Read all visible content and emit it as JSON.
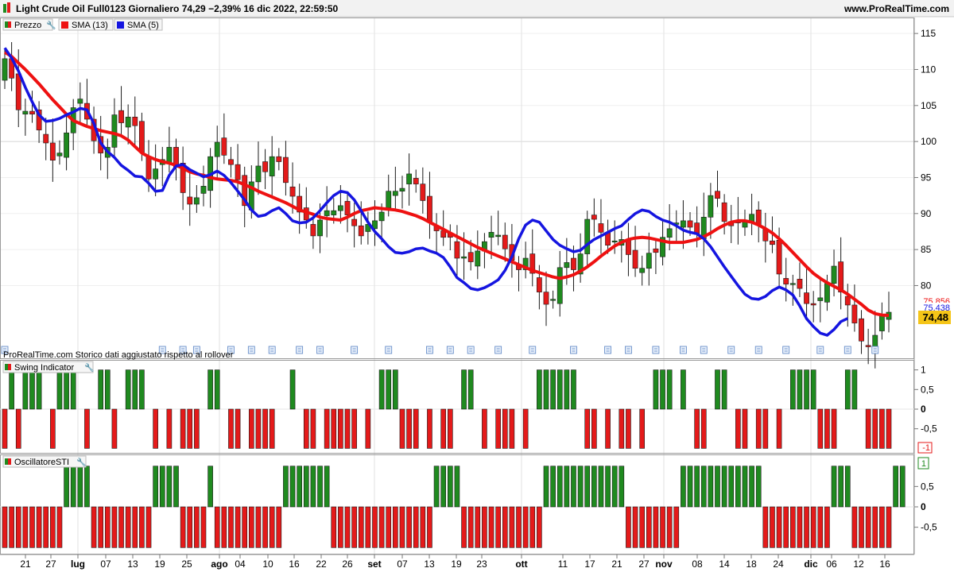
{
  "header": {
    "title": "Light Crude Oil Full0123 Giornaliero 74,29 −2,39% 16 dic 2022, 22:59:50",
    "site": "www.ProRealTime.com"
  },
  "price_panel": {
    "legend": [
      "Prezzo",
      "SMA (13)",
      "SMA (5)"
    ],
    "axis_ticks": [
      "115",
      "110",
      "105",
      "100",
      "95",
      "90",
      "85",
      "80"
    ],
    "label_sma13": "75,856",
    "label_sma5": "75,438",
    "label_last": "74,48",
    "footer": "ProRealTime.com Storico dati aggiustato rispetto al rollover"
  },
  "swing_panel": {
    "title": "Swing Indicator",
    "axis_ticks": [
      "1",
      "0,5",
      "0",
      "-0,5"
    ],
    "label_last": "-1"
  },
  "sti_panel": {
    "title": "OscillatoreSTI",
    "axis_ticks": [
      "0,5",
      "0",
      "-0,5"
    ],
    "label_last": "1"
  },
  "x_axis": {
    "labels": [
      "21",
      "27",
      "lug",
      "07",
      "13",
      "19",
      "25",
      "ago",
      "04",
      "10",
      "16",
      "22",
      "26",
      "set",
      "07",
      "13",
      "19",
      "23",
      "ott",
      "11",
      "17",
      "21",
      "27",
      "nov",
      "08",
      "14",
      "18",
      "24",
      "dic",
      "06",
      "12",
      "16"
    ]
  },
  "colors": {
    "up": "#1f8a1f",
    "down": "#e41a1a",
    "sma13": "#ee1111",
    "sma5": "#1515e0",
    "last_price_bg": "#f5c518"
  },
  "chart_data": {
    "type": "candlestick",
    "title": "Light Crude Oil Full0123 Giornaliero",
    "price_range": [
      72,
      118
    ],
    "sessions": 130,
    "ohlc_close": [
      111.5,
      108.8,
      104.4,
      104.2,
      103.8,
      101.6,
      99.8,
      97.4,
      98.4,
      101.2,
      104.7,
      105.9,
      103.1,
      100.1,
      98.4,
      99.2,
      103.7,
      102.6,
      103.4,
      102.2,
      98.5,
      94.8,
      96.2,
      97.5,
      99.2,
      96.4,
      92.9,
      91.3,
      92.2,
      93.8,
      97.9,
      99.9,
      98.1,
      96.8,
      94.7,
      91.1,
      94.4,
      96.6,
      95.8,
      97.9,
      97.2,
      94.3,
      92.4,
      90.2,
      89.1,
      86.9,
      89.1,
      90.4,
      90.4,
      91.1,
      89.8,
      88.3,
      86.9,
      88.5,
      89.0,
      90.2,
      93.1,
      93.1,
      93.5,
      95.5,
      94.1,
      91.8,
      88.9,
      87.6,
      86.7,
      86.7,
      83.8,
      84.0,
      83.3,
      84.8,
      86.1,
      87.4,
      87.0,
      85.1,
      83.5,
      82.2,
      83.8,
      81.7,
      79.1,
      77.4,
      78.1,
      82.5,
      83.2,
      82.2,
      84.4,
      89.2,
      89.2,
      87.4,
      85.6,
      86.2,
      86.4,
      84.3,
      82.4,
      82.4,
      84.5,
      84.6,
      86.7,
      87.9,
      88.7,
      89.0,
      88.1,
      87.1,
      89.5,
      92.5,
      92.1,
      88.9,
      88.3,
      88.7,
      88.8,
      89.9,
      88.4,
      86.2,
      85.7,
      81.6,
      80.2,
      80.3,
      79.6,
      77.5,
      77.3,
      78.3,
      80.3,
      82.7,
      79.1,
      77.3,
      74.8,
      72.3,
      71.5,
      73.1,
      75.9,
      76.3
    ],
    "sma13": [
      112.4,
      111.8,
      110.9,
      110.0,
      109.0,
      108.0,
      106.9,
      105.8,
      104.8,
      103.8,
      102.9,
      102.5,
      102.1,
      101.8,
      101.5,
      101.3,
      101.1,
      100.8,
      100.2,
      99.3,
      98.4,
      97.9,
      97.5,
      97.2,
      97.0,
      96.7,
      96.3,
      95.8,
      95.5,
      95.3,
      95.0,
      94.8,
      94.7,
      94.6,
      94.4,
      94.0,
      93.6,
      93.1,
      92.7,
      92.3,
      91.9,
      91.5,
      91.0,
      90.5,
      90.2,
      89.9,
      89.5,
      89.3,
      89.2,
      89.1,
      89.5,
      90.0,
      90.4,
      90.6,
      90.8,
      90.7,
      90.6,
      90.5,
      90.3,
      90.0,
      89.7,
      89.3,
      88.8,
      88.3,
      87.8,
      87.3,
      86.8,
      86.3,
      85.8,
      85.3,
      84.9,
      84.5,
      84.1,
      83.7,
      83.3,
      82.9,
      82.5,
      82.1,
      81.8,
      81.5,
      81.2,
      81.0,
      81.2,
      81.5,
      82.0,
      82.6,
      83.3,
      84.1,
      84.8,
      85.5,
      86.0,
      86.4,
      86.6,
      86.7,
      86.6,
      86.4,
      86.2,
      86.0,
      86.0,
      86.0,
      86.2,
      86.4,
      86.8,
      87.3,
      87.9,
      88.4,
      88.8,
      89.0,
      89.0,
      88.8,
      88.4,
      87.9,
      87.3,
      86.5,
      85.6,
      84.6,
      83.6,
      82.6,
      81.7,
      81.0,
      80.4,
      79.9,
      79.4,
      78.8,
      78.1,
      77.4,
      76.6,
      76.1,
      75.9,
      75.86
    ],
    "sma5": [
      113.0,
      111.6,
      109.8,
      107.5,
      105.5,
      103.7,
      102.8,
      102.9,
      103.2,
      103.7,
      104.1,
      104.6,
      104.4,
      102.5,
      99.8,
      98.6,
      97.8,
      96.7,
      96.0,
      95.2,
      95.1,
      94.2,
      93.1,
      93.2,
      95.3,
      96.6,
      96.8,
      96.1,
      95.6,
      95.1,
      95.4,
      95.9,
      95.3,
      94.3,
      93.1,
      91.9,
      90.5,
      89.6,
      89.8,
      90.4,
      90.8,
      90.0,
      89.0,
      88.7,
      88.8,
      89.4,
      90.4,
      91.5,
      92.5,
      93.1,
      92.9,
      91.9,
      90.4,
      88.8,
      87.5,
      86.5,
      85.4,
      84.6,
      84.5,
      84.7,
      85.1,
      85.2,
      84.8,
      84.5,
      83.9,
      82.6,
      81.1,
      80.4,
      79.6,
      79.4,
      79.7,
      80.2,
      80.8,
      82.1,
      84.0,
      86.5,
      88.4,
      89.1,
      88.8,
      87.6,
      86.4,
      85.6,
      85.1,
      84.7,
      84.9,
      85.7,
      86.4,
      86.9,
      87.4,
      87.9,
      88.3,
      89.2,
      90.0,
      90.5,
      90.3,
      89.6,
      89.1,
      88.8,
      88.3,
      87.7,
      87.4,
      87.2,
      86.5,
      85.4,
      84.0,
      82.6,
      81.3,
      80.0,
      78.8,
      78.2,
      78.1,
      78.5,
      79.3,
      79.8,
      79.4,
      78.7,
      77.2,
      75.4,
      74.3,
      73.4,
      73.1,
      73.9,
      75.0,
      75.44
    ],
    "swing_indicator": [
      -1,
      1,
      -1,
      1,
      1,
      1,
      0,
      -1,
      1,
      1,
      1,
      0,
      -1,
      0,
      1,
      1,
      -1,
      0,
      1,
      1,
      1,
      0,
      -1,
      0,
      -1,
      0,
      -1,
      -1,
      -1,
      0,
      1,
      1,
      0,
      -1,
      -1,
      0,
      -1,
      -1,
      -1,
      -1,
      0,
      0,
      1,
      0,
      -1,
      -1,
      0,
      -1,
      -1,
      -1,
      -1,
      -1,
      0,
      -1,
      0,
      1,
      1,
      1,
      -1,
      -1,
      -1,
      0,
      -1,
      0,
      -1,
      -1,
      0,
      1,
      1,
      0,
      -1,
      0,
      -1,
      -1,
      -1,
      0,
      -1,
      0,
      1,
      1,
      1,
      1,
      1,
      1,
      0,
      -1,
      -1,
      0,
      -1,
      0,
      -1,
      -1,
      0,
      -1,
      0,
      1,
      1,
      1,
      0,
      1,
      0,
      -1,
      -1,
      0,
      1,
      1,
      0,
      -1,
      -1,
      0,
      -1,
      -1,
      0,
      -1,
      0,
      1,
      1,
      1,
      1,
      -1,
      -1,
      -1,
      0,
      1,
      1,
      0,
      -1,
      -1,
      -1,
      -1
    ],
    "oscillatore_sti": [
      -1,
      -1,
      -1,
      -1,
      -1,
      -1,
      -1,
      -1,
      -1,
      1,
      1,
      1,
      1,
      -1,
      -1,
      -1,
      -1,
      -1,
      -1,
      -1,
      -1,
      -1,
      1,
      1,
      1,
      1,
      -1,
      -1,
      -1,
      -1,
      1,
      -1,
      -1,
      -1,
      -1,
      -1,
      -1,
      -1,
      -1,
      -1,
      -1,
      1,
      1,
      1,
      1,
      1,
      1,
      1,
      -1,
      -1,
      -1,
      -1,
      -1,
      -1,
      -1,
      -1,
      -1,
      -1,
      -1,
      -1,
      -1,
      -1,
      -1,
      1,
      1,
      1,
      1,
      -1,
      -1,
      -1,
      -1,
      -1,
      -1,
      -1,
      -1,
      -1,
      -1,
      -1,
      -1,
      1,
      1,
      1,
      1,
      1,
      1,
      1,
      1,
      1,
      1,
      1,
      1,
      -1,
      -1,
      -1,
      -1,
      -1,
      -1,
      -1,
      -1,
      1,
      1,
      1,
      1,
      1,
      1,
      1,
      1,
      1,
      1,
      1,
      1,
      -1,
      -1,
      -1,
      -1,
      -1,
      -1,
      -1,
      -1,
      -1,
      -1,
      1,
      1,
      1,
      -1,
      -1,
      -1,
      -1,
      -1,
      -1,
      1,
      1
    ]
  }
}
